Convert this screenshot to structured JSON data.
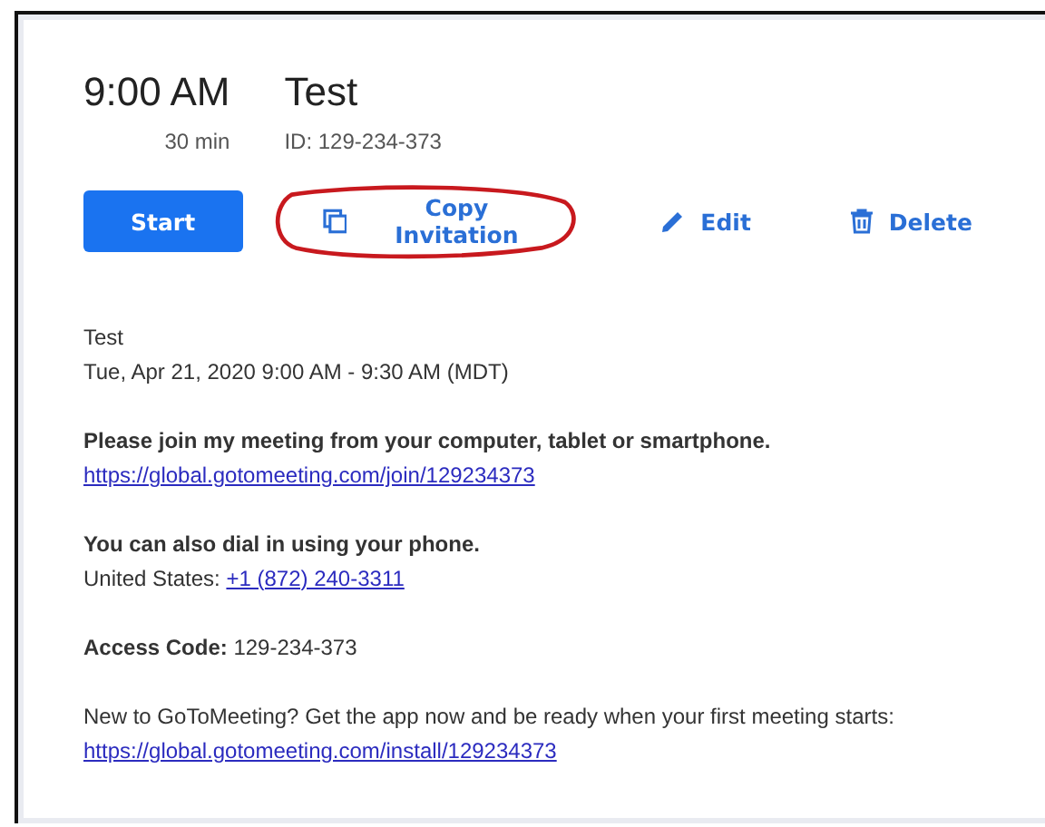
{
  "meeting": {
    "time": "9:00 AM",
    "duration": "30 min",
    "title": "Test",
    "meeting_id": "ID: 129-234-373"
  },
  "actions": [
    {
      "kind": "start",
      "label": "Start",
      "circled": false
    },
    {
      "kind": "copy",
      "label": "Copy Invitation",
      "circled": true
    },
    {
      "kind": "edit",
      "label": "Edit",
      "circled": false
    },
    {
      "kind": "delete",
      "label": "Delete",
      "circled": false
    }
  ],
  "invitation": [
    {
      "lines": [
        {
          "kind": "text",
          "text": "Test"
        },
        {
          "kind": "text",
          "text": "Tue, Apr 21, 2020 9:00 AM - 9:30 AM (MDT)"
        }
      ]
    },
    {
      "lines": [
        {
          "kind": "bold",
          "text": "Please join my meeting from your computer, tablet or smartphone."
        },
        {
          "kind": "link",
          "text": "https://global.gotomeeting.com/join/129234373"
        }
      ]
    },
    {
      "lines": [
        {
          "kind": "bold",
          "text": "You can also dial in using your phone."
        },
        {
          "kind": "label_link",
          "label": "United States:",
          "text": "+1 (872) 240-3311"
        }
      ]
    },
    {
      "lines": [
        {
          "kind": "text",
          "text": "**Access Code:** 129-234-373"
        }
      ]
    },
    {
      "lines": [
        {
          "kind": "text",
          "text": "New to GoToMeeting? Get the app now and be ready when your first meeting starts:"
        },
        {
          "kind": "link",
          "text": "https://global.gotomeeting.com/install/129234373"
        }
      ]
    }
  ]
}
